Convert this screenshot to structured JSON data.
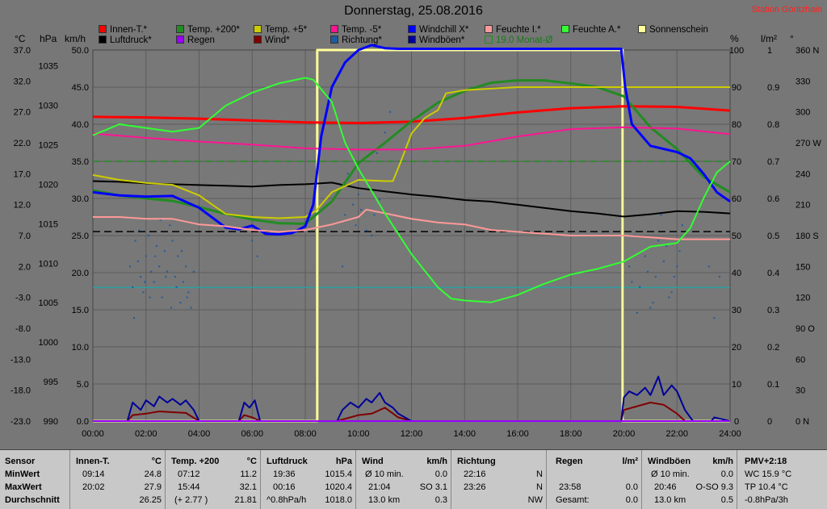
{
  "header": {
    "title": "Donnerstag, 25.08.2016",
    "station": "Station Göritzhain"
  },
  "axis_units": {
    "celsius": "°C",
    "hpa": "hPa",
    "kmh": "km/h",
    "percent": "%",
    "rain": "l/m²",
    "degree": "°"
  },
  "legend": [
    {
      "label": "Innen-T.*",
      "color": "#ff0000"
    },
    {
      "label": "Luftdruck*",
      "color": "#000000"
    },
    {
      "label": "Temp. +200*",
      "color": "#228b22"
    },
    {
      "label": "Regen",
      "color": "#9900ff"
    },
    {
      "label": "Temp. +5*",
      "color": "#cccc00"
    },
    {
      "label": "Wind*",
      "color": "#800000"
    },
    {
      "label": "Temp. -5*",
      "color": "#ff1493"
    },
    {
      "label": "Richtung*",
      "color": "#1e5aa0"
    },
    {
      "label": "Windchill X*",
      "color": "#0000ff"
    },
    {
      "label": "Windböen*",
      "color": "#000099"
    },
    {
      "label": "Feuchte I.*",
      "color": "#ff9999"
    },
    {
      "label": "19.0 Monat-Ø",
      "color": "#228b22"
    },
    {
      "label": "Feuchte A.*",
      "color": "#33ff33"
    },
    {
      "label": "Sonnenschein",
      "color": "#ffff99"
    }
  ],
  "chart_data": {
    "type": "line",
    "x_ticks": [
      "00:00",
      "02:00",
      "04:00",
      "06:00",
      "08:00",
      "10:00",
      "12:00",
      "14:00",
      "16:00",
      "18:00",
      "20:00",
      "22:00",
      "24:00"
    ],
    "x_range": [
      0,
      24
    ],
    "axes": {
      "c_temp": {
        "ticks": [
          "37.0",
          "32.0",
          "27.0",
          "22.0",
          "17.0",
          "12.0",
          "7.0",
          "2.0",
          "-3.0",
          "-8.0",
          "-13.0",
          "-18.0",
          "-23.0"
        ],
        "range": [
          -23,
          37
        ]
      },
      "hpa": {
        "ticks": [
          "1035",
          "1030",
          "1025",
          "1020",
          "1015",
          "1010",
          "1005",
          "1000",
          "995",
          "990"
        ],
        "range": [
          990,
          1037
        ]
      },
      "kmh": {
        "ticks": [
          "50.0",
          "45.0",
          "40.0",
          "35.0",
          "30.0",
          "25.0",
          "20.0",
          "15.0",
          "10.0",
          "5.0",
          "0.0"
        ],
        "range": [
          0,
          50
        ]
      },
      "percent": {
        "ticks": [
          "100",
          "90",
          "80",
          "70",
          "60",
          "50",
          "40",
          "30",
          "20",
          "10",
          "0"
        ],
        "range": [
          0,
          100
        ]
      },
      "rain": {
        "ticks": [
          "1",
          "0.9",
          "0.8",
          "0.7",
          "0.6",
          "0.5",
          "0.4",
          "0.3",
          "0.2",
          "0.1",
          "0"
        ],
        "range": [
          0,
          1
        ]
      },
      "direction": {
        "ticks": [
          "360 N",
          "330",
          "300",
          "270 W",
          "240",
          "210",
          "180 S",
          "150",
          "120",
          "90 O",
          "60",
          "30",
          "0 N"
        ],
        "range": [
          0,
          360
        ]
      }
    },
    "series": [
      {
        "name": "Innen-T.*",
        "unit": "°C",
        "color": "#ff0000",
        "width": 3,
        "x": [
          0,
          2,
          4,
          6,
          8,
          10,
          12,
          14,
          16,
          18,
          20,
          22,
          24
        ],
        "y": [
          26.2,
          26.1,
          25.9,
          25.6,
          25.3,
          25.2,
          25.4,
          26.0,
          26.9,
          27.6,
          27.9,
          27.8,
          27.2
        ]
      },
      {
        "name": "Luftdruck*",
        "unit": "hPa",
        "color": "#000000",
        "width": 2,
        "x": [
          0,
          1,
          2,
          3,
          4,
          5,
          6,
          7,
          8,
          9,
          10,
          11,
          12,
          13,
          14,
          15,
          16,
          17,
          18,
          19,
          20,
          21,
          22,
          23,
          24
        ],
        "y": [
          1020.4,
          1020.3,
          1020.1,
          1020.0,
          1019.9,
          1019.8,
          1019.7,
          1019.9,
          1020.0,
          1020.2,
          1019.5,
          1019.1,
          1018.7,
          1018.4,
          1018.0,
          1017.8,
          1017.4,
          1017.0,
          1016.6,
          1016.3,
          1015.9,
          1016.2,
          1016.6,
          1016.5,
          1016.3
        ]
      },
      {
        "name": "Temp. +200*",
        "unit": "°C",
        "color": "#228b22",
        "width": 3,
        "x": [
          0,
          1,
          2,
          3,
          4,
          5,
          6,
          7,
          8,
          9,
          10,
          11,
          12,
          13,
          14,
          15,
          16,
          17,
          18,
          19,
          20,
          21,
          22,
          23,
          24
        ],
        "y": [
          14.3,
          13.5,
          13.0,
          12.6,
          11.6,
          10.5,
          9.6,
          9.0,
          8.9,
          12.5,
          18.7,
          22.0,
          25.5,
          28.5,
          30.4,
          31.7,
          32.1,
          32.1,
          31.6,
          31.0,
          29.5,
          24.5,
          21.0,
          16.5,
          14.0
        ]
      },
      {
        "name": "Temp. +5*",
        "unit": "°C",
        "color": "#cccc00",
        "width": 2,
        "x": [
          0,
          1,
          2,
          3,
          4,
          5,
          6,
          7,
          8,
          8.4,
          9,
          10,
          11,
          11.3,
          11.6,
          12,
          12.5,
          13,
          13.3,
          14,
          16,
          18,
          20,
          22,
          24
        ],
        "y": [
          16.8,
          16.0,
          15.5,
          15.2,
          13.5,
          10.5,
          10.0,
          9.8,
          10.0,
          11.0,
          14.0,
          16.0,
          15.8,
          15.8,
          19.0,
          23.5,
          26.0,
          27.3,
          30.0,
          30.5,
          31.0,
          31.0,
          31.0,
          31.0,
          31.0
        ]
      },
      {
        "name": "Temp. -5*",
        "unit": "°C",
        "color": "#ff1493",
        "width": 2,
        "x": [
          0,
          2,
          4,
          6,
          8,
          10,
          12,
          14,
          16,
          18,
          20,
          22,
          24
        ],
        "y": [
          23.5,
          22.8,
          22.2,
          21.7,
          21.1,
          20.9,
          20.9,
          21.5,
          23.0,
          24.2,
          24.5,
          24.3,
          23.4
        ]
      },
      {
        "name": "Windchill X*",
        "unit": "°C",
        "color": "#0000ff",
        "width": 3,
        "x": [
          0,
          1,
          2,
          3,
          4,
          5,
          5.5,
          6,
          6.5,
          7,
          7.5,
          8,
          8.3,
          8.6,
          9,
          9.5,
          10,
          10.5,
          11,
          11.5,
          12,
          14,
          16,
          18,
          19.9,
          20.05,
          20.3,
          21,
          22,
          22.5,
          23,
          23.5,
          24
        ],
        "y": [
          14.0,
          13.5,
          13.3,
          13.4,
          11.5,
          8.3,
          8.0,
          8.6,
          7.3,
          7.2,
          7.4,
          8.5,
          12.0,
          23.0,
          31.0,
          35.0,
          37.0,
          37.8,
          37.3,
          37.2,
          37.2,
          37.2,
          37.2,
          37.2,
          37.2,
          31.0,
          25.0,
          21.5,
          20.5,
          19.5,
          17.0,
          14.0,
          12.5
        ]
      },
      {
        "name": "Feuchte I.*",
        "unit": "%",
        "color": "#ff9999",
        "width": 2,
        "x": [
          0,
          1,
          2,
          3,
          4,
          5,
          6,
          7,
          8,
          9,
          10,
          10.3,
          11,
          12,
          13,
          14,
          15,
          16,
          17,
          18,
          19,
          20,
          21,
          22,
          24
        ],
        "y": [
          55.0,
          55.0,
          54.5,
          54.5,
          53.0,
          52.5,
          51.5,
          51.0,
          51.5,
          53.0,
          55.0,
          57.0,
          56.0,
          54.5,
          53.5,
          53.0,
          51.5,
          51.0,
          50.5,
          50.0,
          50.0,
          50.0,
          49.5,
          49.0,
          49.0
        ]
      },
      {
        "name": "Feuchte A.*",
        "unit": "%",
        "color": "#33ff33",
        "width": 2,
        "x": [
          0,
          1,
          2,
          3,
          4,
          5,
          6,
          7,
          8,
          8.3,
          9,
          9.5,
          10,
          11,
          12,
          13,
          13.5,
          14,
          15,
          16,
          17,
          18,
          19,
          20,
          21,
          22,
          22.5,
          23,
          23.5,
          24
        ],
        "y": [
          77.0,
          80.0,
          79.0,
          78.0,
          79.0,
          85.0,
          88.5,
          91.0,
          92.5,
          92.0,
          86.0,
          75.0,
          68.0,
          56.0,
          45.0,
          36.0,
          33.0,
          32.5,
          32.0,
          34.0,
          37.0,
          39.5,
          41.0,
          43.0,
          47.0,
          48.0,
          52.0,
          60.0,
          67.0,
          70.0
        ]
      },
      {
        "name": "Sonnenschein",
        "unit": "",
        "color": "#ffff99",
        "width": 3,
        "x": [
          0,
          8.45,
          8.45,
          19.95,
          19.95,
          24
        ],
        "y": [
          0,
          0,
          100,
          100,
          0,
          0
        ]
      },
      {
        "name": "Wind*",
        "unit": "km/h",
        "color": "#800000",
        "width": 2,
        "x": [
          0,
          1.3,
          1.5,
          2,
          2.5,
          3,
          3.5,
          4,
          5.5,
          5.7,
          6,
          6.3,
          9.2,
          9.5,
          10,
          10.5,
          11,
          11.5,
          12,
          19.9,
          20,
          20.5,
          21,
          21.5,
          22,
          22.3,
          24
        ],
        "y": [
          0,
          0,
          0.8,
          1.0,
          1.3,
          1.2,
          1.1,
          0,
          0,
          0.8,
          0.5,
          0,
          0,
          0.3,
          0.8,
          1.0,
          1.8,
          0.5,
          0,
          0,
          1.5,
          2.0,
          2.5,
          2.2,
          1.0,
          0,
          0
        ]
      },
      {
        "name": "Windböen*",
        "unit": "km/h",
        "color": "#000099",
        "width": 2,
        "x": [
          0,
          1.3,
          1.5,
          1.8,
          2,
          2.3,
          2.5,
          2.8,
          3,
          3.3,
          3.5,
          3.8,
          4,
          5.5,
          5.7,
          5.9,
          6.1,
          6.3,
          9.2,
          9.4,
          9.7,
          10,
          10.3,
          10.5,
          10.8,
          11,
          11.3,
          11.5,
          12,
          19.9,
          20,
          20.2,
          20.5,
          20.8,
          21,
          21.3,
          21.5,
          21.8,
          22,
          22.3,
          22.6,
          23.3,
          23.4,
          24
        ],
        "y": [
          0,
          0,
          2.5,
          1.5,
          2.8,
          2.0,
          3.3,
          2.5,
          3.0,
          2.2,
          2.8,
          1.5,
          0,
          0,
          2.5,
          1.8,
          2.8,
          0,
          0,
          1.5,
          2.5,
          1.8,
          3.0,
          2.5,
          3.8,
          2.5,
          1.8,
          1.0,
          0,
          0,
          3.2,
          4.0,
          3.5,
          4.5,
          3.5,
          6.0,
          3.5,
          4.8,
          4.0,
          1.5,
          0,
          0,
          0.5,
          0
        ]
      },
      {
        "name": "Regen",
        "unit": "l/m²",
        "color": "#9900ff",
        "width": 2,
        "x": [
          0,
          24
        ],
        "y": [
          0,
          0
        ]
      }
    ],
    "richtung_points": {
      "unit": "°",
      "color": "#1e5aa0",
      "x": [
        1.4,
        1.5,
        1.6,
        1.7,
        1.8,
        1.9,
        2.0,
        2.1,
        2.2,
        2.3,
        2.4,
        2.5,
        2.6,
        2.7,
        2.8,
        2.9,
        3.0,
        3.1,
        3.2,
        3.3,
        3.4,
        3.5,
        3.6,
        3.7,
        3.8,
        1.55,
        1.75,
        1.95,
        2.15,
        2.35,
        2.55,
        2.75,
        2.95,
        3.15,
        3.35,
        3.55,
        6.0,
        6.1,
        6.2,
        9.4,
        9.5,
        9.6,
        9.7,
        9.8,
        9.9,
        10.0,
        10.1,
        10.2,
        10.3,
        10.4,
        10.5,
        10.6,
        10.7,
        10.8,
        11.0,
        11.2,
        20.2,
        20.4,
        20.6,
        20.8,
        21.0,
        21.2,
        21.4,
        21.6,
        21.8,
        22.0,
        22.2,
        20.3,
        20.5,
        20.7,
        20.9,
        21.1,
        21.3,
        21.5,
        21.7,
        21.9,
        22.1,
        23.2,
        23.4,
        23.6
      ],
      "y": [
        150,
        130,
        175,
        155,
        140,
        125,
        160,
        180,
        145,
        135,
        170,
        150,
        120,
        165,
        145,
        190,
        175,
        140,
        160,
        115,
        135,
        150,
        125,
        110,
        145,
        100,
        185,
        135,
        120,
        160,
        195,
        140,
        110,
        130,
        165,
        120,
        175,
        195,
        160,
        150,
        200,
        240,
        230,
        210,
        190,
        220,
        205,
        235,
        185,
        225,
        180,
        200,
        260,
        215,
        280,
        300,
        150,
        180,
        130,
        160,
        110,
        140,
        200,
        170,
        125,
        150,
        190,
        135,
        105,
        165,
        145,
        115,
        175,
        155,
        120,
        140,
        165,
        150,
        100,
        140
      ]
    },
    "reference_lines": [
      {
        "label": "19.0 Monat-Ø",
        "unit": "°C",
        "value": 19.0,
        "color": "#228b22",
        "style": "dashed"
      },
      {
        "unit": "hPa",
        "value": 1014,
        "color": "#000000",
        "style": "dashed"
      },
      {
        "unit": "km/h",
        "value": 18.0,
        "color": "#2aa0a0",
        "style": "solid"
      }
    ]
  },
  "stats": {
    "labels": {
      "sensor": "Sensor",
      "min": "MinWert",
      "max": "MaxWert",
      "avg": "Durchschnitt"
    },
    "innen": {
      "title": "Innen-T.",
      "unit": "°C",
      "min_time": "09:14",
      "min_val": "24.8",
      "max_time": "20:02",
      "max_val": "27.9",
      "avg_val": "26.25"
    },
    "temp200": {
      "title": "Temp. +200",
      "unit": "°C",
      "min_time": "07:12",
      "min_val": "11.2",
      "max_time": "15:44",
      "max_val": "32.1",
      "avg_note": "(+ 2.77 )",
      "avg_val": "21.81"
    },
    "luftdruck": {
      "title": "Luftdruck",
      "unit": "hPa",
      "min_time": "19:36",
      "min_val": "1015.4",
      "max_time": "00:16",
      "max_val": "1020.4",
      "avg_note": "^0.8hPa/h",
      "avg_val": "1018.0"
    },
    "wind": {
      "title": "Wind",
      "unit": "km/h",
      "min_label": "Ø 10 min.",
      "min_val": "0.0",
      "max_time": "21:04",
      "max_val": "SO 3.1",
      "avg_label": "13.0 km",
      "avg_val": "0.3"
    },
    "richtung": {
      "title": "Richtung",
      "min_time": "22:16",
      "min_val": "N",
      "max_time": "23:26",
      "max_val": "N",
      "avg_val": "NW"
    },
    "regen": {
      "title": "Regen",
      "unit": "l/m²",
      "max_time": "23:58",
      "max_val": "0.0",
      "avg_label": "Gesamt:",
      "avg_val": "0.0"
    },
    "windboen": {
      "title": "Windböen",
      "unit": "km/h",
      "min_label": "Ø 10 min.",
      "min_val": "0.0",
      "max_time": "20:46",
      "max_val": "O-SO 9.3",
      "avg_label": "13.0 km",
      "avg_val": "0.5"
    },
    "pmv": {
      "title": "PMV+2:18",
      "wc": "WC 15.9 °C",
      "tp": "TP 10.4 °C",
      "trend": "-0.8hPa/3h"
    }
  }
}
